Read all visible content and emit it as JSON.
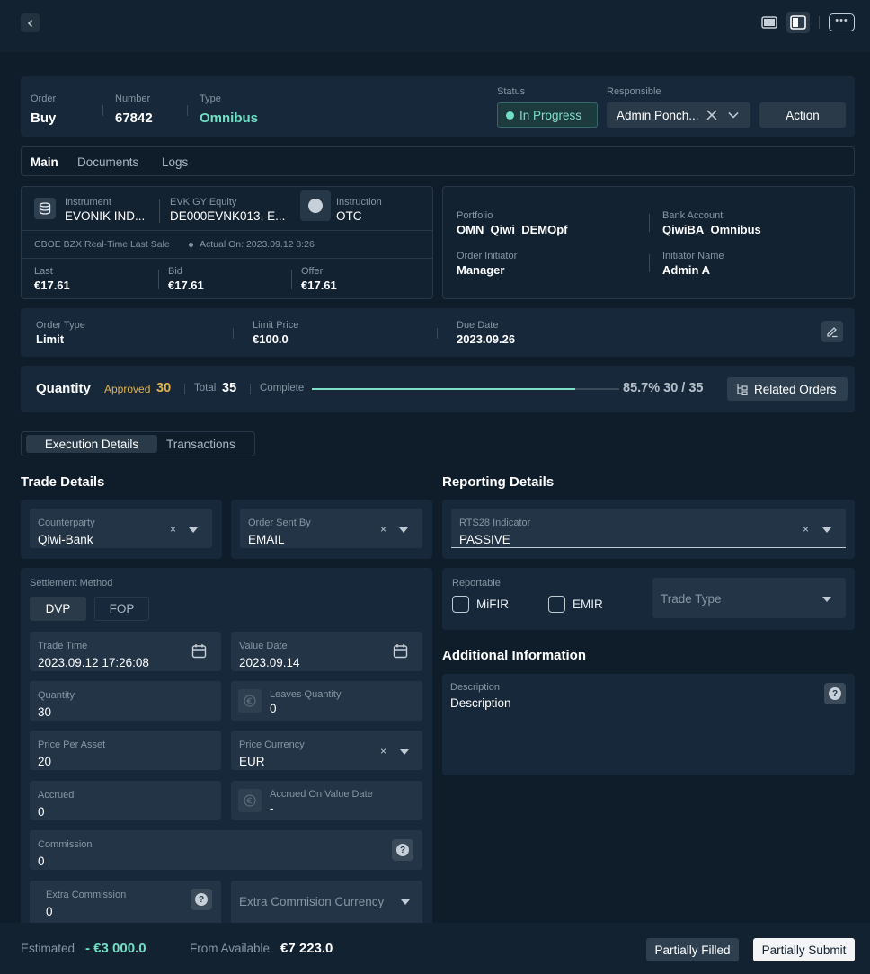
{
  "header": {
    "order_label": "Order",
    "order_value": "Buy",
    "number_label": "Number",
    "number_value": "67842",
    "type_label": "Type",
    "type_value": "Omnibus",
    "status_label": "Status",
    "status_value": "In Progress",
    "responsible_label": "Responsible",
    "responsible_value": "Admin Ponch...",
    "action_label": "Action"
  },
  "tabs": [
    "Main",
    "Documents",
    "Logs"
  ],
  "instrument": {
    "instrument_label": "Instrument",
    "instrument_value": "EVONIK IND...",
    "equity_label": "EVK GY Equity",
    "equity_value": "DE000EVNK013, E...",
    "instruction_label": "Instruction",
    "instruction_value": "OTC",
    "feed": "CBOE BZX Real-Time Last Sale",
    "actual_on": "Actual On: 2023.09.12 8:26",
    "last_label": "Last",
    "last_value": "€17.61",
    "bid_label": "Bid",
    "bid_value": "€17.61",
    "offer_label": "Offer",
    "offer_value": "€17.61"
  },
  "portfolio": {
    "portfolio_label": "Portfolio",
    "portfolio_value": "OMN_Qiwi_DEMOpf",
    "bank_label": "Bank Account",
    "bank_value": "QiwiBA_Omnibus",
    "initiator_label": "Order Initiator",
    "initiator_value": "Manager",
    "initiator_name_label": "Initiator Name",
    "initiator_name_value": "Admin A"
  },
  "order_info": {
    "order_type_label": "Order Type",
    "order_type_value": "Limit",
    "limit_price_label": "Limit Price",
    "limit_price_value": "€100.0",
    "due_date_label": "Due Date",
    "due_date_value": "2023.09.26"
  },
  "quantity": {
    "title": "Quantity",
    "approved_label": "Approved",
    "approved_value": "30",
    "total_label": "Total",
    "total_value": "35",
    "complete_label": "Complete",
    "complete_fraction": 0.857,
    "complete_text": "85.7% 30 / 35",
    "related_label": "Related Orders"
  },
  "sub_tabs": [
    "Execution Details",
    "Transactions"
  ],
  "trade": {
    "title": "Trade Details",
    "counterparty_label": "Counterparty",
    "counterparty_value": "Qiwi-Bank",
    "sent_by_label": "Order Sent By",
    "sent_by_value": "EMAIL",
    "settlement_label": "Settlement Method",
    "settlement_options": [
      "DVP",
      "FOP"
    ],
    "trade_time_label": "Trade Time",
    "trade_time_value": "2023.09.12 17:26:08",
    "value_date_label": "Value Date",
    "value_date_value": "2023.09.14",
    "quantity_label": "Quantity",
    "quantity_value": "30",
    "leaves_label": "Leaves Quantity",
    "leaves_value": "0",
    "price_label": "Price Per Asset",
    "price_value": "20",
    "currency_label": "Price Currency",
    "currency_value": "EUR",
    "accrued_label": "Accrued",
    "accrued_value": "0",
    "accrued_vd_label": "Accrued On Value Date",
    "accrued_vd_value": "-",
    "commission_label": "Commission",
    "commission_value": "0",
    "extra_commission_label": "Extra Commission",
    "extra_commission_value": "0",
    "extra_currency_placeholder": "Extra Commision Currency"
  },
  "reporting": {
    "title": "Reporting Details",
    "rts28_label": "RTS28 Indicator",
    "rts28_value": "PASSIVE",
    "reportable_label": "Reportable",
    "mifir_label": "MiFIR",
    "emir_label": "EMIR",
    "trade_type_placeholder": "Trade Type"
  },
  "additional": {
    "title": "Additional Information",
    "description_label": "Description",
    "description_value": "Description"
  },
  "footer": {
    "estimated_label": "Estimated",
    "estimated_value": "- €3 000.0",
    "available_label": "From Available",
    "available_value": "€7 223.0",
    "partially_filled_label": "Partially Filled",
    "partially_submit_label": "Partially Submit"
  },
  "colors": {
    "accent": "#6fe0c4",
    "approved": "#e3b04b",
    "background": "#0f1d2b",
    "panel": "#17283a"
  }
}
